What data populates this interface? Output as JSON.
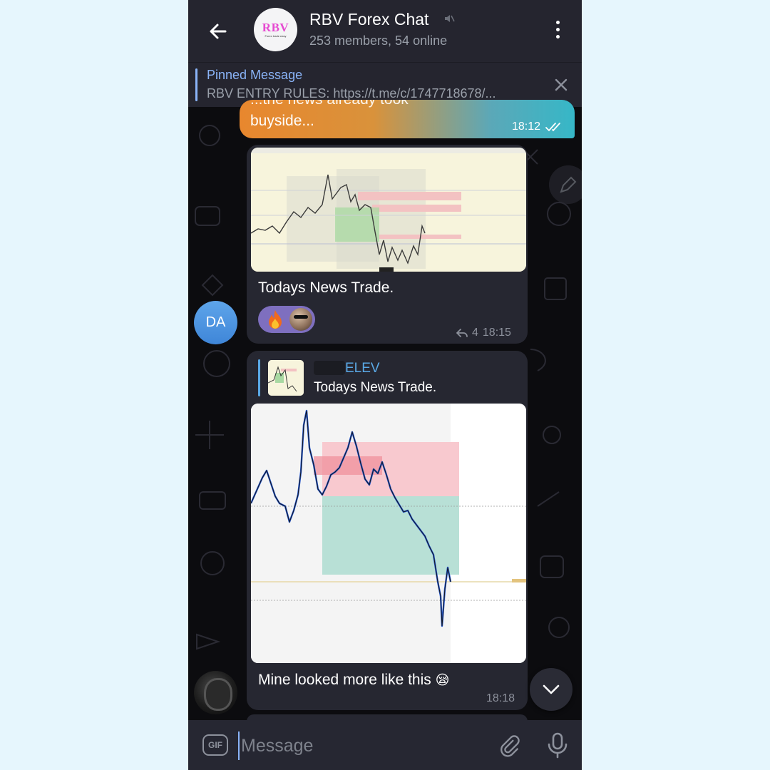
{
  "header": {
    "title": "RBV Forex Chat",
    "subtitle": "253 members, 54 online",
    "avatar_logo": "RBV",
    "avatar_logo_sub": "Forex trade easy",
    "back_icon": "arrow-left-icon",
    "mute_icon": "muted-speaker-icon",
    "menu_icon": "more-vertical-icon"
  },
  "pinned": {
    "title": "Pinned Message",
    "text": "RBV ENTRY RULES: https://t.me/c/1747718678/..."
  },
  "messages": [
    {
      "type": "outgoing",
      "cut_text": "...the news already took",
      "text": "buyside...",
      "time": "18:12",
      "status": "read"
    },
    {
      "type": "incoming",
      "sender_initials": "DA",
      "caption": "Todays News Trade.",
      "reactions": [
        "🔥",
        "user-avatar"
      ],
      "reply_count": "4",
      "time": "18:15"
    },
    {
      "type": "incoming",
      "reply_to": {
        "name": "ELEV",
        "text": "Todays News Trade."
      },
      "caption": "Mine looked more like this",
      "emoji": "😪",
      "time": "18:18"
    }
  ],
  "composer": {
    "gif_label": "GIF",
    "placeholder": "Message"
  },
  "colors": {
    "accent": "#8ab4f8",
    "reply_name": "#5aa9e6",
    "bubble_in": "#262731",
    "header_bg": "#25252f",
    "reaction_bg": "#7e6fbf"
  }
}
